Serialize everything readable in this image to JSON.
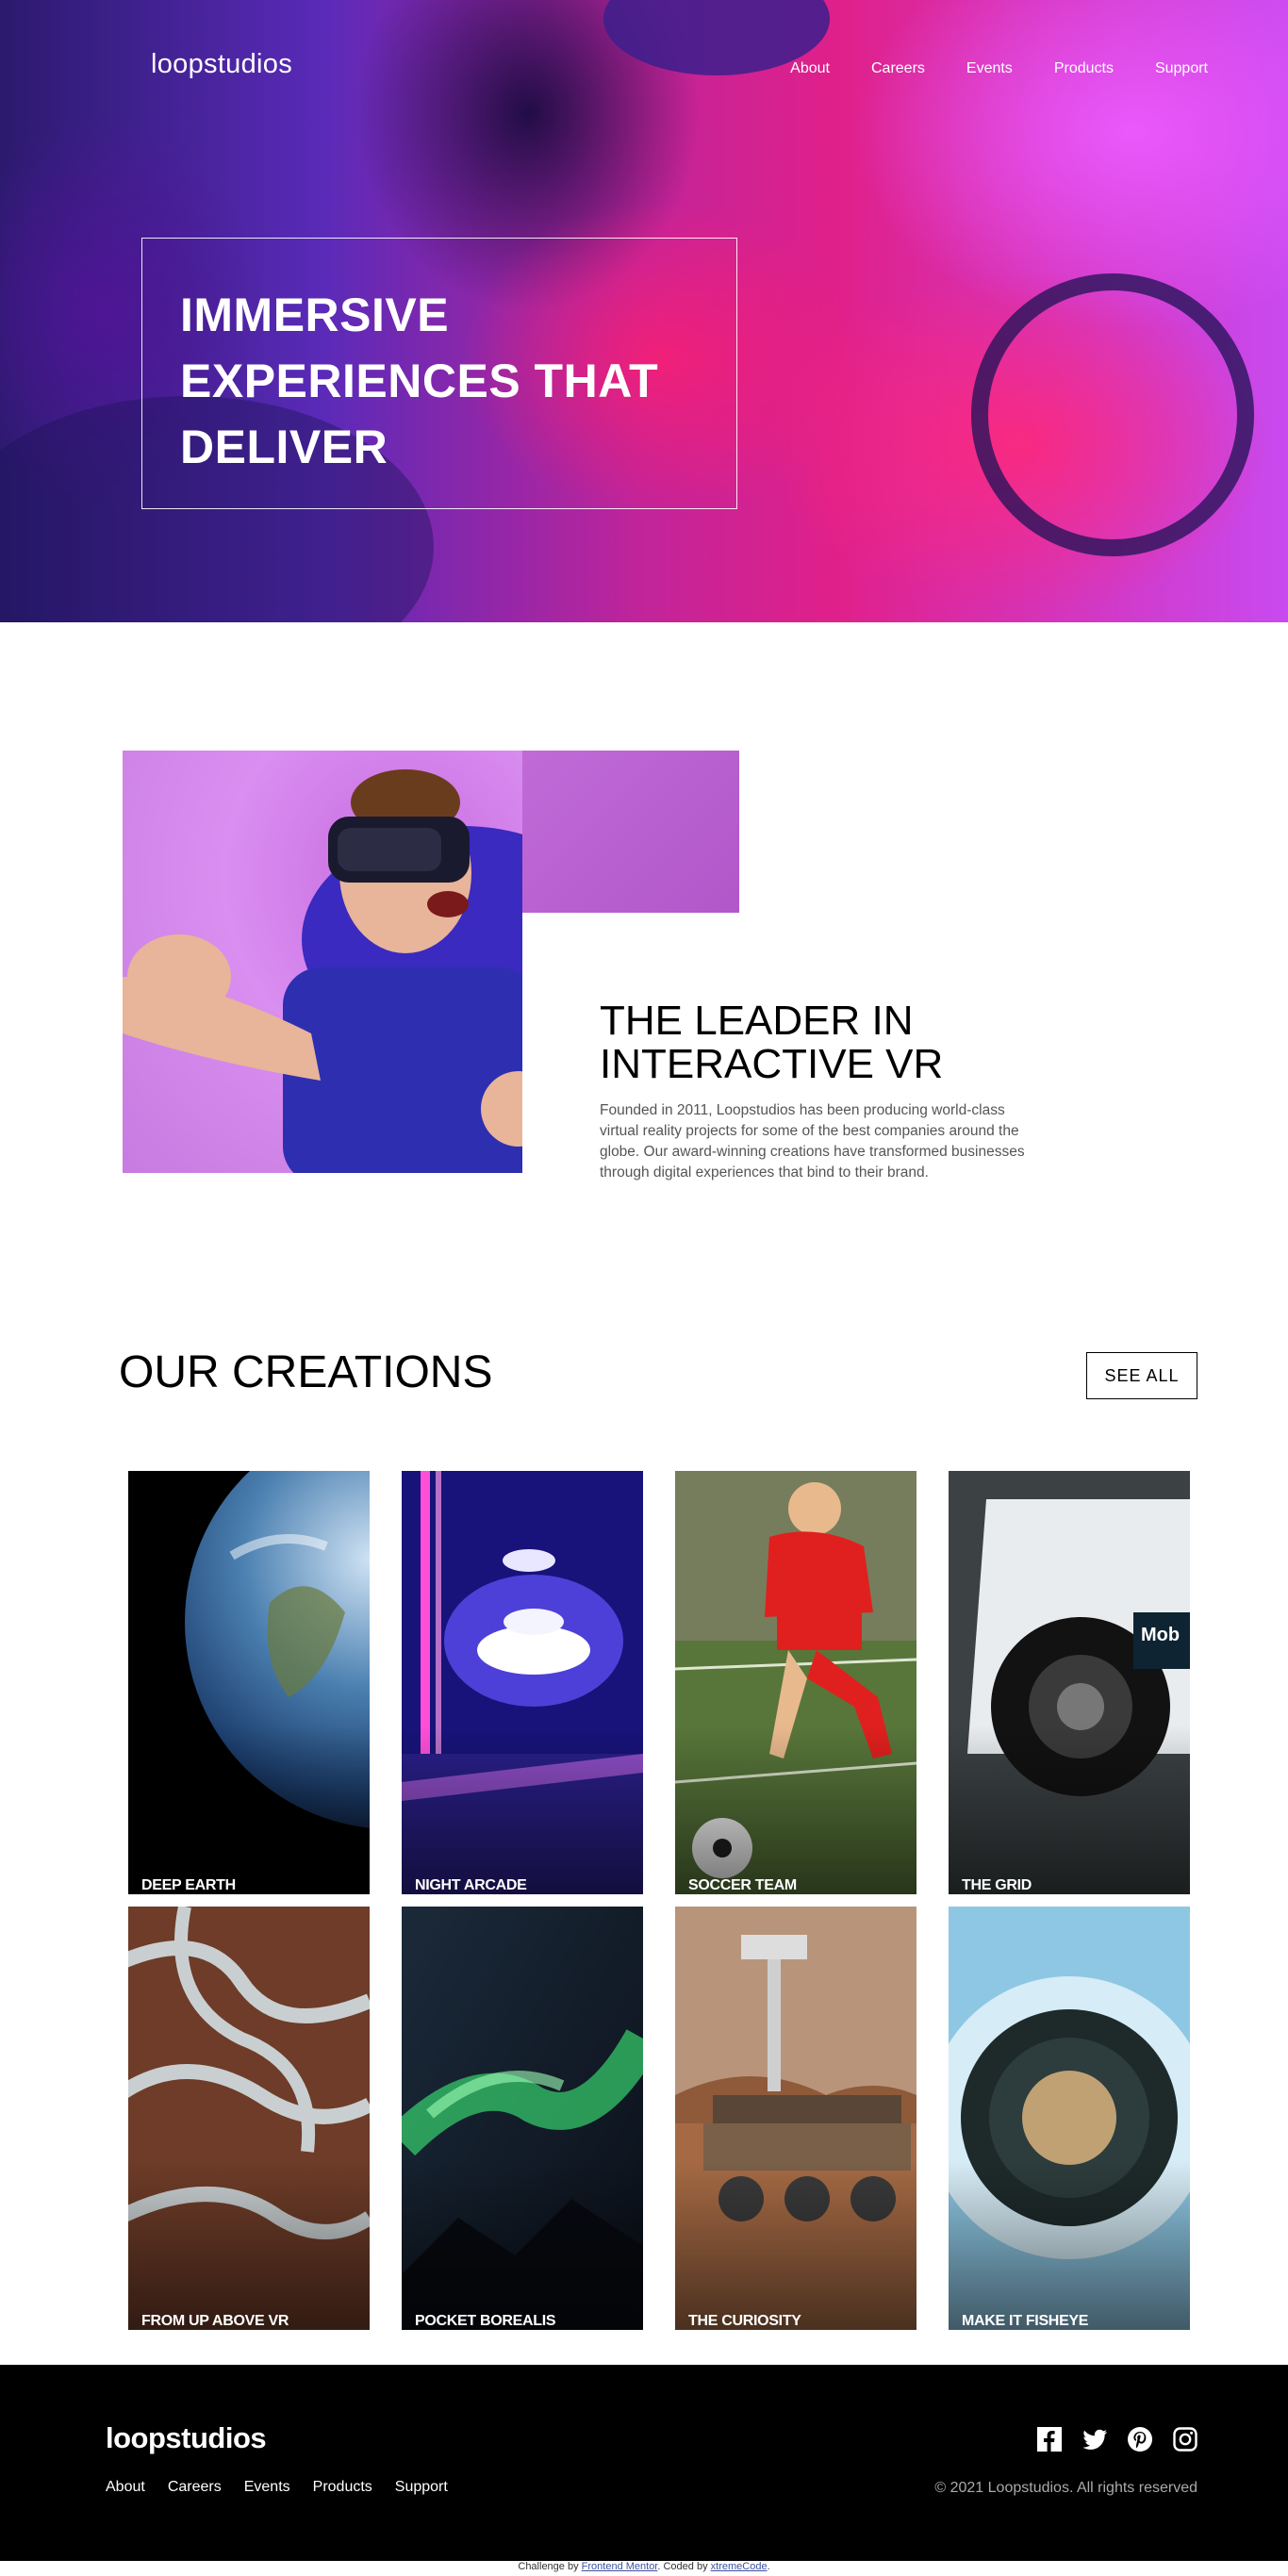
{
  "header": {
    "logo": "loopstudios",
    "nav": [
      "About",
      "Careers",
      "Events",
      "Products",
      "Support"
    ]
  },
  "hero": {
    "title": "IMMERSIVE EXPERIENCES THAT DELIVER"
  },
  "about": {
    "title": "THE LEADER IN INTERACTIVE VR",
    "text": "Founded in 2011, Loopstudios has been producing world-class virtual reality projects for some of the best companies around the globe. Our award-winning creations have transformed businesses through digital experiences that bind to their brand."
  },
  "creations": {
    "title": "OUR CREATIONS",
    "see_all": "SEE ALL",
    "items": [
      {
        "label": "DEEP EARTH"
      },
      {
        "label": "NIGHT ARCADE"
      },
      {
        "label": "SOCCER TEAM"
      },
      {
        "label": "THE GRID"
      },
      {
        "label": "FROM UP ABOVE VR"
      },
      {
        "label": "POCKET BOREALIS"
      },
      {
        "label": "THE CURIOSITY"
      },
      {
        "label": "MAKE IT FISHEYE"
      }
    ]
  },
  "footer": {
    "logo": "loopstudios",
    "nav": [
      "About",
      "Careers",
      "Events",
      "Products",
      "Support"
    ],
    "copyright": "© 2021 Loopstudios. All rights reserved",
    "social_icons": [
      "facebook-icon",
      "twitter-icon",
      "pinterest-icon",
      "instagram-icon"
    ]
  },
  "attribution": {
    "prefix": "Challenge by",
    "link1": "Frontend Mentor",
    "middle": ". Coded by",
    "link2": "xtremeCode",
    "suffix": "."
  }
}
